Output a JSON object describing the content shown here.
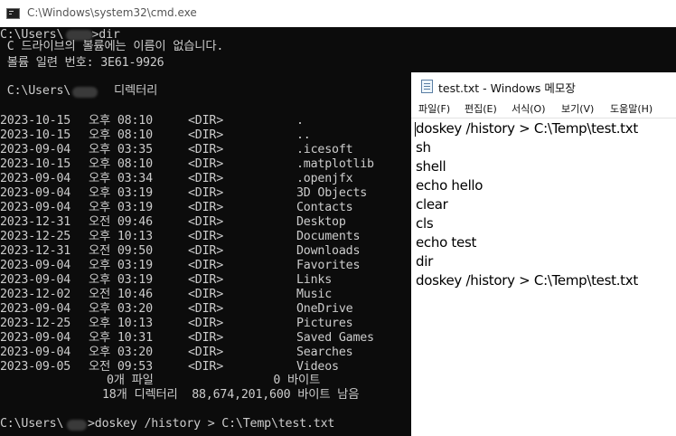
{
  "cmd": {
    "title": "C:\\Windows\\system32\\cmd.exe",
    "prompt_dir": "C:\\Users\\    >dir",
    "volume_line": " C 드라이브의 볼륨에는 이름이 없습니다.",
    "serial_line": " 볼륨 일련 번호: 3E61-9926",
    "dir_header_prefix": " C:\\Users\\",
    "dir_header_suffix": "디렉터리",
    "entries": [
      {
        "date": "2023-10-15",
        "time": "오후 08:10",
        "type": "<DIR>",
        "name": "."
      },
      {
        "date": "2023-10-15",
        "time": "오후 08:10",
        "type": "<DIR>",
        "name": ".."
      },
      {
        "date": "2023-09-04",
        "time": "오후 03:35",
        "type": "<DIR>",
        "name": ".icesoft"
      },
      {
        "date": "2023-10-15",
        "time": "오후 08:10",
        "type": "<DIR>",
        "name": ".matplotlib"
      },
      {
        "date": "2023-09-04",
        "time": "오후 03:34",
        "type": "<DIR>",
        "name": ".openjfx"
      },
      {
        "date": "2023-09-04",
        "time": "오후 03:19",
        "type": "<DIR>",
        "name": "3D Objects"
      },
      {
        "date": "2023-09-04",
        "time": "오후 03:19",
        "type": "<DIR>",
        "name": "Contacts"
      },
      {
        "date": "2023-12-31",
        "time": "오전 09:46",
        "type": "<DIR>",
        "name": "Desktop"
      },
      {
        "date": "2023-12-25",
        "time": "오후 10:13",
        "type": "<DIR>",
        "name": "Documents"
      },
      {
        "date": "2023-12-31",
        "time": "오전 09:50",
        "type": "<DIR>",
        "name": "Downloads"
      },
      {
        "date": "2023-09-04",
        "time": "오후 03:19",
        "type": "<DIR>",
        "name": "Favorites"
      },
      {
        "date": "2023-09-04",
        "time": "오후 03:19",
        "type": "<DIR>",
        "name": "Links"
      },
      {
        "date": "2023-12-02",
        "time": "오전 10:46",
        "type": "<DIR>",
        "name": "Music"
      },
      {
        "date": "2023-09-04",
        "time": "오후 03:20",
        "type": "<DIR>",
        "name": "OneDrive"
      },
      {
        "date": "2023-12-25",
        "time": "오후 10:13",
        "type": "<DIR>",
        "name": "Pictures"
      },
      {
        "date": "2023-09-04",
        "time": "오후 10:31",
        "type": "<DIR>",
        "name": "Saved Games"
      },
      {
        "date": "2023-09-04",
        "time": "오후 03:20",
        "type": "<DIR>",
        "name": "Searches"
      },
      {
        "date": "2023-09-05",
        "time": "오전 09:53",
        "type": "<DIR>",
        "name": "Videos"
      }
    ],
    "summary_files": "0개 파일                 0 바이트",
    "summary_dirs": "18개 디렉터리  88,674,201,600 바이트 남음",
    "last_prompt_prefix": "C:\\Users\\",
    "last_command": ">doskey /history > C:\\Temp\\test.txt"
  },
  "notepad": {
    "title": "test.txt - Windows 메모장",
    "menu": [
      "파일(F)",
      "편집(E)",
      "서식(O)",
      "보기(V)",
      "도움말(H)"
    ],
    "lines": [
      "doskey /history > C:\\Temp\\test.txt",
      "sh",
      "shell",
      "echo hello",
      "clear",
      "cls",
      "echo test",
      "dir",
      "doskey /history > C:\\Temp\\test.txt"
    ]
  }
}
